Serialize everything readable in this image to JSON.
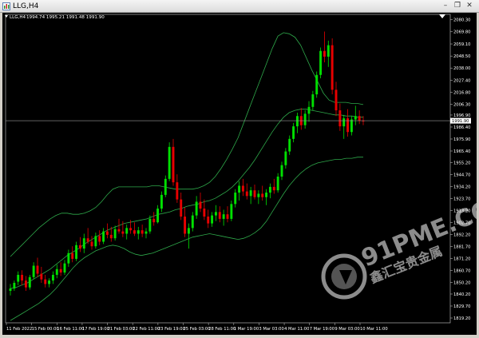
{
  "window": {
    "title": "LLG,H4",
    "minimize_glyph": "–",
    "restore_glyph": "❐",
    "close_glyph": "✕"
  },
  "chart_info": {
    "symbol_label": "LLG,H4",
    "ohlc_text": "1994.74 1995.21 1991.48 1991.90",
    "current_price": "1991.90"
  },
  "watermark": {
    "text": "91PME.COM",
    "subtitle": "鑫汇宝贵金属"
  },
  "colors": {
    "background": "#000000",
    "bull": "#00e000",
    "bear": "#e80000",
    "band": "#2ea84a",
    "text": "#ffffff",
    "price_line": "#9a9a9a"
  },
  "chart_data": {
    "type": "candlestick",
    "title": "",
    "xlabel": "",
    "ylabel": "",
    "ylim": [
      1815,
      2085
    ],
    "y_ticks": [
      "2080.30",
      "2069.80",
      "2059.10",
      "2048.50",
      "2038.00",
      "2027.40",
      "2016.80",
      "2006.30",
      "1996.90",
      "1986.40",
      "1975.90",
      "1965.40",
      "1955.20",
      "1944.70",
      "1934.20",
      "1923.70",
      "1913.20",
      "1902.70",
      "1892.20",
      "1881.70",
      "1871.20",
      "1860.70",
      "1850.20",
      "1840.20",
      "1829.70",
      "1819.20"
    ],
    "x_ticks": [
      "11 Feb 2022",
      "15 Feb 00:00",
      "16 Feb 11:00",
      "17 Feb 19:00",
      "21 Feb 03:00",
      "22 Feb 11:00",
      "23 Feb 19:00",
      "25 Feb 03:00",
      "28 Feb 11:00",
      "1 Mar 19:00",
      "3 Mar 03:00",
      "4 Mar 11:00",
      "7 Mar 19:00",
      "9 Mar 03:00",
      "10 Mar 11:00"
    ],
    "candles": [
      [
        1843,
        1849,
        1839,
        1845
      ],
      [
        1845,
        1852,
        1843,
        1850
      ],
      [
        1851,
        1860,
        1848,
        1857
      ],
      [
        1857,
        1861,
        1848,
        1852
      ],
      [
        1852,
        1856,
        1843,
        1846
      ],
      [
        1846,
        1857,
        1844,
        1855
      ],
      [
        1855,
        1868,
        1853,
        1865
      ],
      [
        1865,
        1872,
        1855,
        1858
      ],
      [
        1858,
        1864,
        1850,
        1853
      ],
      [
        1853,
        1857,
        1846,
        1849
      ],
      [
        1849,
        1854,
        1846,
        1852
      ],
      [
        1852,
        1860,
        1849,
        1857
      ],
      [
        1857,
        1866,
        1854,
        1862
      ],
      [
        1862,
        1868,
        1856,
        1859
      ],
      [
        1859,
        1870,
        1857,
        1867
      ],
      [
        1867,
        1879,
        1864,
        1876
      ],
      [
        1876,
        1882,
        1868,
        1871
      ],
      [
        1871,
        1886,
        1869,
        1883
      ],
      [
        1883,
        1890,
        1877,
        1880
      ],
      [
        1880,
        1893,
        1876,
        1889
      ],
      [
        1889,
        1898,
        1884,
        1886
      ],
      [
        1886,
        1891,
        1879,
        1882
      ],
      [
        1882,
        1894,
        1880,
        1891
      ],
      [
        1891,
        1896,
        1883,
        1886
      ],
      [
        1886,
        1898,
        1884,
        1895
      ],
      [
        1895,
        1902,
        1889,
        1892
      ],
      [
        1892,
        1899,
        1886,
        1889
      ],
      [
        1889,
        1900,
        1887,
        1897
      ],
      [
        1897,
        1906,
        1893,
        1895
      ],
      [
        1895,
        1904,
        1890,
        1893
      ],
      [
        1893,
        1901,
        1888,
        1898
      ],
      [
        1898,
        1905,
        1893,
        1896
      ],
      [
        1896,
        1903,
        1891,
        1893
      ],
      [
        1893,
        1899,
        1888,
        1896
      ],
      [
        1896,
        1901,
        1890,
        1893
      ],
      [
        1893,
        1898,
        1889,
        1895
      ],
      [
        1895,
        1909,
        1893,
        1906
      ],
      [
        1906,
        1912,
        1900,
        1903
      ],
      [
        1903,
        1918,
        1902,
        1915
      ],
      [
        1915,
        1930,
        1912,
        1927
      ],
      [
        1927,
        1944,
        1925,
        1941
      ],
      [
        1941,
        1973,
        1939,
        1969
      ],
      [
        1969,
        1976,
        1935,
        1938
      ],
      [
        1938,
        1945,
        1920,
        1923
      ],
      [
        1923,
        1929,
        1905,
        1908
      ],
      [
        1908,
        1916,
        1890,
        1893
      ],
      [
        1893,
        1902,
        1880,
        1898
      ],
      [
        1898,
        1912,
        1895,
        1909
      ],
      [
        1909,
        1926,
        1906,
        1921
      ],
      [
        1921,
        1929,
        1912,
        1915
      ],
      [
        1915,
        1923,
        1905,
        1908
      ],
      [
        1908,
        1914,
        1898,
        1902
      ],
      [
        1902,
        1912,
        1899,
        1909
      ],
      [
        1909,
        1918,
        1904,
        1912
      ],
      [
        1912,
        1917,
        1903,
        1906
      ],
      [
        1906,
        1914,
        1900,
        1910
      ],
      [
        1910,
        1917,
        1903,
        1906
      ],
      [
        1906,
        1922,
        1904,
        1919
      ],
      [
        1919,
        1932,
        1916,
        1929
      ],
      [
        1929,
        1939,
        1922,
        1935
      ],
      [
        1935,
        1941,
        1926,
        1930
      ],
      [
        1930,
        1937,
        1923,
        1926
      ],
      [
        1926,
        1934,
        1919,
        1931
      ],
      [
        1931,
        1936,
        1923,
        1925
      ],
      [
        1925,
        1931,
        1919,
        1928
      ],
      [
        1928,
        1935,
        1922,
        1925
      ],
      [
        1925,
        1932,
        1918,
        1929
      ],
      [
        1929,
        1937,
        1924,
        1934
      ],
      [
        1934,
        1941,
        1928,
        1931
      ],
      [
        1931,
        1946,
        1929,
        1943
      ],
      [
        1943,
        1956,
        1940,
        1953
      ],
      [
        1953,
        1968,
        1950,
        1965
      ],
      [
        1965,
        1979,
        1962,
        1976
      ],
      [
        1976,
        1990,
        1973,
        1987
      ],
      [
        1987,
        1999,
        1981,
        1996
      ],
      [
        1996,
        2003,
        1984,
        1988
      ],
      [
        1988,
        2001,
        1985,
        1998
      ],
      [
        1998,
        2009,
        1991,
        2004
      ],
      [
        2004,
        2018,
        2001,
        2015
      ],
      [
        2015,
        2035,
        2012,
        2032
      ],
      [
        2032,
        2056,
        2029,
        2053
      ],
      [
        2053,
        2070,
        2043,
        2048
      ],
      [
        2048,
        2062,
        2039,
        2058
      ],
      [
        2058,
        2064,
        2015,
        2019
      ],
      [
        2019,
        2026,
        1996,
        2001
      ],
      [
        2001,
        2007,
        1983,
        1987
      ],
      [
        1987,
        1997,
        1976,
        1994
      ],
      [
        1994,
        2002,
        1978,
        1982
      ],
      [
        1982,
        1996,
        1979,
        1993
      ],
      [
        1993,
        2005,
        1988,
        1996
      ],
      [
        1996,
        2001,
        1989,
        1992
      ],
      [
        1992,
        1996,
        1988,
        1991.9
      ]
    ],
    "bands": {
      "upper": [
        1873,
        1878,
        1883,
        1888,
        1893,
        1898,
        1902,
        1906,
        1909,
        1911,
        1911,
        1910,
        1910,
        1911,
        1913,
        1916,
        1921,
        1927,
        1932,
        1934,
        1934,
        1934,
        1934,
        1934,
        1934,
        1935,
        1935,
        1934,
        1933,
        1932,
        1932,
        1932,
        1932,
        1933,
        1935,
        1938,
        1943,
        1950,
        1958,
        1967,
        1977,
        1990,
        2003,
        2016,
        2029,
        2042,
        2055,
        2066,
        2069,
        2068,
        2065,
        2058,
        2047,
        2036,
        2026,
        2016,
        2010,
        2008,
        2008,
        2008,
        2007,
        2007,
        2006
      ],
      "middle": [
        1845,
        1846,
        1848,
        1850,
        1853,
        1856,
        1859,
        1862,
        1866,
        1870,
        1874,
        1877,
        1880,
        1884,
        1887,
        1890,
        1893,
        1896,
        1898,
        1900,
        1902,
        1903,
        1904,
        1905,
        1906,
        1908,
        1910,
        1911,
        1912,
        1914,
        1915,
        1917,
        1918,
        1919,
        1921,
        1922,
        1924,
        1927,
        1930,
        1934,
        1939,
        1945,
        1951,
        1958,
        1966,
        1974,
        1982,
        1989,
        1995,
        1999,
        2001,
        2002,
        2002,
        2001,
        2000,
        1999,
        1998,
        1997,
        1997,
        1996,
        1996,
        1995,
        1995
      ],
      "lower": [
        1817,
        1820,
        1823,
        1826,
        1829,
        1832,
        1836,
        1840,
        1845,
        1851,
        1857,
        1863,
        1868,
        1872,
        1875,
        1878,
        1880,
        1882,
        1883,
        1882,
        1880,
        1877,
        1875,
        1874,
        1875,
        1876,
        1878,
        1880,
        1882,
        1884,
        1886,
        1888,
        1890,
        1891,
        1892,
        1893,
        1892,
        1891,
        1890,
        1889,
        1888,
        1889,
        1891,
        1894,
        1898,
        1904,
        1912,
        1920,
        1928,
        1935,
        1941,
        1946,
        1950,
        1953,
        1955,
        1956,
        1957,
        1958,
        1958,
        1959,
        1959,
        1960,
        1960
      ]
    }
  }
}
